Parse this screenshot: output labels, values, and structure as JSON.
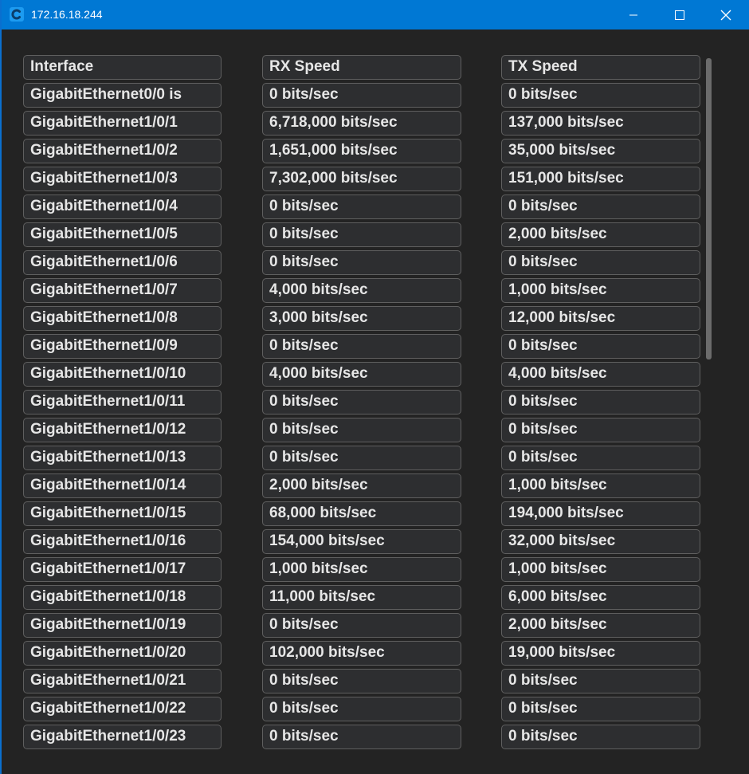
{
  "window": {
    "title": "172.16.18.244",
    "accent": "#0078d4"
  },
  "table": {
    "headers": [
      "Interface",
      "RX Speed",
      "TX Speed"
    ],
    "rows": [
      [
        "GigabitEthernet0/0 is",
        "0 bits/sec",
        "0 bits/sec"
      ],
      [
        "GigabitEthernet1/0/1",
        "6,718,000 bits/sec",
        "137,000 bits/sec"
      ],
      [
        "GigabitEthernet1/0/2",
        "1,651,000 bits/sec",
        "35,000 bits/sec"
      ],
      [
        "GigabitEthernet1/0/3",
        "7,302,000 bits/sec",
        "151,000 bits/sec"
      ],
      [
        "GigabitEthernet1/0/4",
        "0 bits/sec",
        "0 bits/sec"
      ],
      [
        "GigabitEthernet1/0/5",
        "0 bits/sec",
        "2,000 bits/sec"
      ],
      [
        "GigabitEthernet1/0/6",
        "0 bits/sec",
        "0 bits/sec"
      ],
      [
        "GigabitEthernet1/0/7",
        "4,000 bits/sec",
        "1,000 bits/sec"
      ],
      [
        "GigabitEthernet1/0/8",
        "3,000 bits/sec",
        "12,000 bits/sec"
      ],
      [
        "GigabitEthernet1/0/9",
        "0 bits/sec",
        "0 bits/sec"
      ],
      [
        "GigabitEthernet1/0/10",
        "4,000 bits/sec",
        "4,000 bits/sec"
      ],
      [
        "GigabitEthernet1/0/11",
        "0 bits/sec",
        "0 bits/sec"
      ],
      [
        "GigabitEthernet1/0/12",
        "0 bits/sec",
        "0 bits/sec"
      ],
      [
        "GigabitEthernet1/0/13",
        "0 bits/sec",
        "0 bits/sec"
      ],
      [
        "GigabitEthernet1/0/14",
        "2,000 bits/sec",
        "1,000 bits/sec"
      ],
      [
        "GigabitEthernet1/0/15",
        "68,000 bits/sec",
        "194,000 bits/sec"
      ],
      [
        "GigabitEthernet1/0/16",
        "154,000 bits/sec",
        "32,000 bits/sec"
      ],
      [
        "GigabitEthernet1/0/17",
        "1,000 bits/sec",
        "1,000 bits/sec"
      ],
      [
        "GigabitEthernet1/0/18",
        "11,000 bits/sec",
        "6,000 bits/sec"
      ],
      [
        "GigabitEthernet1/0/19",
        "0 bits/sec",
        "2,000 bits/sec"
      ],
      [
        "GigabitEthernet1/0/20",
        "102,000 bits/sec",
        "19,000 bits/sec"
      ],
      [
        "GigabitEthernet1/0/21",
        "0 bits/sec",
        "0 bits/sec"
      ],
      [
        "GigabitEthernet1/0/22",
        "0 bits/sec",
        "0 bits/sec"
      ],
      [
        "GigabitEthernet1/0/23",
        "0 bits/sec",
        "0 bits/sec"
      ]
    ]
  }
}
